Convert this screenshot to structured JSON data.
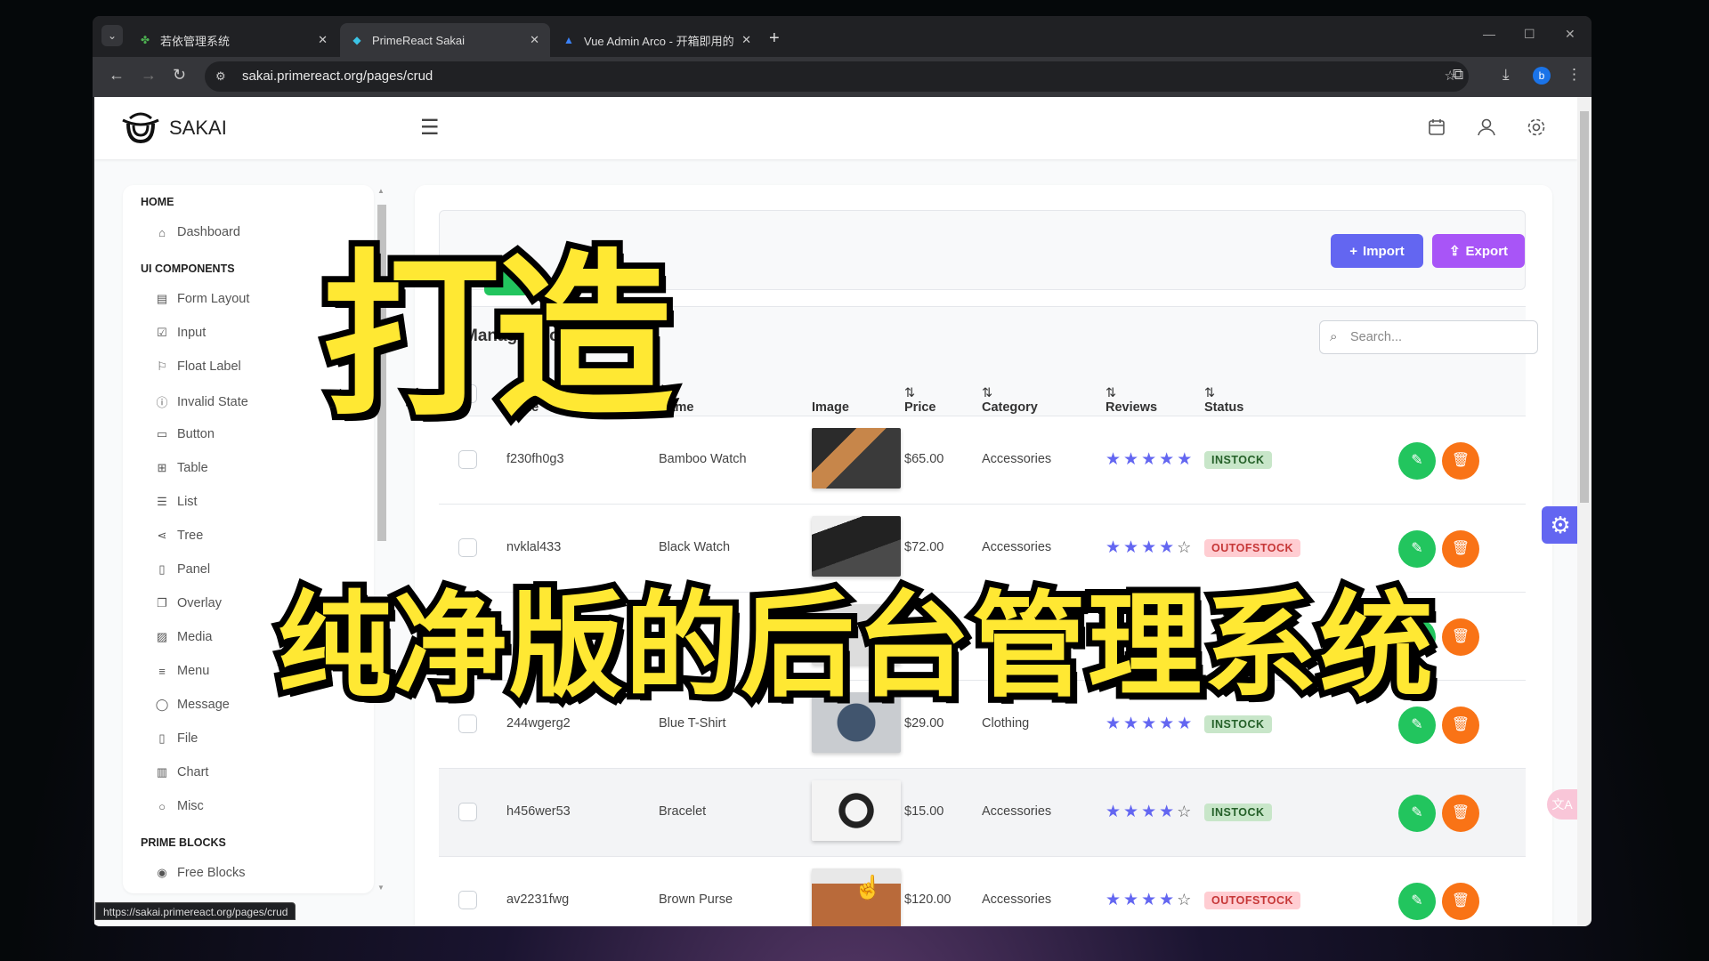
{
  "browser": {
    "tabs": [
      {
        "title": "若依管理系统",
        "icon": "leaf-icon",
        "active": false
      },
      {
        "title": "PrimeReact Sakai",
        "icon": "prime-icon",
        "active": true
      },
      {
        "title": "Vue Admin Arco - 开箱即用的",
        "icon": "arco-icon",
        "active": false
      }
    ],
    "url": "sakai.primereact.org/pages/crud",
    "profile_initial": "b",
    "status_url": "https://sakai.primereact.org/pages/crud"
  },
  "app": {
    "brand": "SAKAI",
    "sidebar": {
      "sections": [
        {
          "title": "HOME",
          "items": [
            {
              "label": "Dashboard",
              "icon": "⌂"
            }
          ]
        },
        {
          "title": "UI COMPONENTS",
          "items": [
            {
              "label": "Form Layout",
              "icon": "▤"
            },
            {
              "label": "Input",
              "icon": "☑"
            },
            {
              "label": "Float Label",
              "icon": "⚐"
            },
            {
              "label": "Invalid State",
              "icon": "ⓘ"
            },
            {
              "label": "Button",
              "icon": "▭"
            },
            {
              "label": "Table",
              "icon": "⊞"
            },
            {
              "label": "List",
              "icon": "☰"
            },
            {
              "label": "Tree",
              "icon": "⋖"
            },
            {
              "label": "Panel",
              "icon": "▯"
            },
            {
              "label": "Overlay",
              "icon": "❐"
            },
            {
              "label": "Media",
              "icon": "▨"
            },
            {
              "label": "Menu",
              "icon": "≡"
            },
            {
              "label": "Message",
              "icon": "◯"
            },
            {
              "label": "File",
              "icon": "▯"
            },
            {
              "label": "Chart",
              "icon": "▥"
            },
            {
              "label": "Misc",
              "icon": "○"
            }
          ]
        },
        {
          "title": "PRIME BLOCKS",
          "items": [
            {
              "label": "Free Blocks",
              "icon": "◉"
            }
          ]
        }
      ]
    },
    "toolbar": {
      "import_label": "Import",
      "export_label": "Export",
      "import_color": "#6366f1",
      "export_color": "#a855f7"
    },
    "table": {
      "title": "Manage Products",
      "search_placeholder": "Search...",
      "columns": [
        "Code",
        "Name",
        "Image",
        "Price",
        "Category",
        "Reviews",
        "Status"
      ],
      "rows": [
        {
          "code": "f230fh0g3",
          "name": "Bamboo Watch",
          "price": "$65.00",
          "category": "Accessories",
          "rating": 5,
          "status": "INSTOCK"
        },
        {
          "code": "nvklal433",
          "name": "Black Watch",
          "price": "$72.00",
          "category": "Accessories",
          "rating": 4,
          "status": "OUTOFSTOCK"
        },
        {
          "code": "",
          "name": "",
          "price": "",
          "category": "",
          "rating": 0,
          "status": ""
        },
        {
          "code": "244wgerg2",
          "name": "Blue T-Shirt",
          "price": "$29.00",
          "category": "Clothing",
          "rating": 5,
          "status": "INSTOCK"
        },
        {
          "code": "h456wer53",
          "name": "Bracelet",
          "price": "$15.00",
          "category": "Accessories",
          "rating": 4,
          "status": "INSTOCK"
        },
        {
          "code": "av2231fwg",
          "name": "Brown Purse",
          "price": "$120.00",
          "category": "Accessories",
          "rating": 4,
          "status": "OUTOFSTOCK"
        }
      ]
    }
  },
  "overlay": {
    "line1": "打造",
    "line2": "纯净版的后台管理系统",
    "color": "#ffe833"
  }
}
